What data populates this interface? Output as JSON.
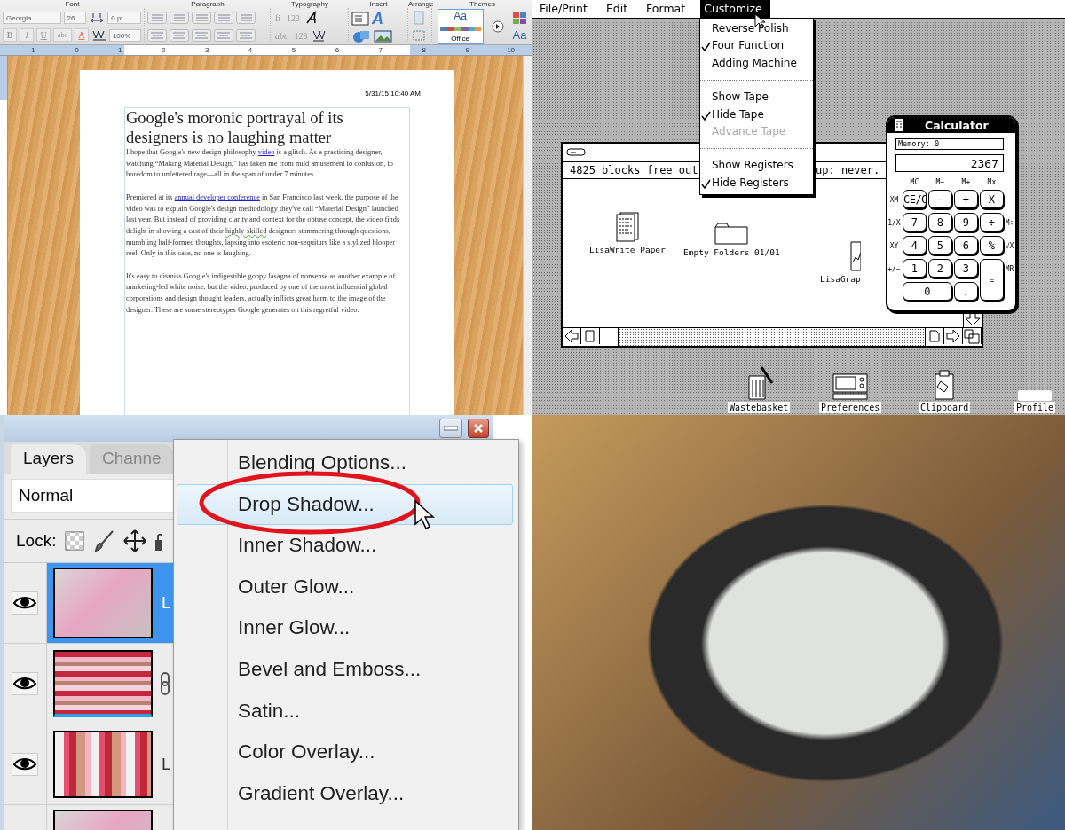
{
  "word": {
    "toolbar": {
      "groups": [
        "Font",
        "Paragraph",
        "Typography",
        "Insert",
        "Arrange",
        "Themes"
      ],
      "font": "Georgia",
      "font_size": "26",
      "spacing": "0 pt",
      "scale": "100%",
      "format_buttons": [
        {
          "label": "B",
          "kind": "bold"
        },
        {
          "label": "I",
          "kind": "italic"
        },
        {
          "label": "U",
          "kind": "underline"
        },
        {
          "label": "abc",
          "kind": "strike"
        },
        {
          "label": "A",
          "kind": "color"
        }
      ],
      "typography_buttons": [
        "fi",
        "123",
        "abc",
        "123"
      ],
      "wordart": "A",
      "theme_sample": "Aa",
      "theme_name": "Office",
      "fonts_button": "Aa"
    },
    "ruler": [
      "1",
      "0",
      "1",
      "2",
      "3",
      "4",
      "5",
      "6",
      "7",
      "8",
      "9",
      "10"
    ],
    "document": {
      "timestamp": "5/31/15 10:40 AM",
      "title": "Google's moronic portrayal of its designers is no laughing matter",
      "paragraphs": [
        [
          {
            "text": "I hope that Google's new design philosophy "
          },
          {
            "text": "video",
            "kind": "link"
          },
          {
            "text": " is a glitch. As a practicing designer, watching “Making Material Design,” has taken me from mild amusement to confusion, to boredom to unfettered rage—all in the span of under 7 minutes."
          }
        ],
        [
          {
            "text": "Premiered at its "
          },
          {
            "text": "annual developer conference",
            "kind": "link"
          },
          {
            "text": " in San Francisco last week, the purpose of the video was to explain Google's design methodology they've call “Material Design” launched last year. But instead of providing clarity and context for the obtuse concept, the video finds delight in showing a cast of their "
          },
          {
            "text": "highly-skilled",
            "kind": "grammar"
          },
          {
            "text": " designers stammering through questions, mumbling half-formed thoughts, lapsing into esoteric non-sequiturs like a stylized blooper reel. Only in this case, no one is laughing."
          }
        ],
        [
          {
            "text": "It's easy to dismiss Google's indigestible goopy lasagna of nonsense as another example of marketing-led white noise, but the video, produced by one of the most influential global corporations and design thought leaders, actually inflicts great harm to the image of the designer. These are some stereotypes Google generates on this regretful video."
          }
        ]
      ]
    }
  },
  "lisa": {
    "menus": [
      {
        "label": "File/Print",
        "selected": false
      },
      {
        "label": "Edit",
        "selected": false
      },
      {
        "label": "Format",
        "selected": false
      },
      {
        "label": "Customize",
        "selected": true
      }
    ],
    "dropdown": [
      {
        "kind": "item",
        "label": "Reverse Polish",
        "checked": false,
        "disabled": false
      },
      {
        "kind": "item",
        "label": "Four Function",
        "checked": true,
        "disabled": false
      },
      {
        "kind": "item",
        "label": "Adding Machine",
        "checked": false,
        "disabled": false
      },
      {
        "kind": "separator"
      },
      {
        "kind": "item",
        "label": "Show Tape",
        "checked": false,
        "disabled": false
      },
      {
        "kind": "item",
        "label": "Hide Tape",
        "checked": true,
        "disabled": false
      },
      {
        "kind": "item",
        "label": "Advance Tape",
        "checked": false,
        "disabled": true
      },
      {
        "kind": "separator"
      },
      {
        "kind": "item",
        "label": "Show Registers",
        "checked": false,
        "disabled": false
      },
      {
        "kind": "item",
        "label": "Hide Registers",
        "checked": true,
        "disabled": false
      }
    ],
    "window": {
      "status_left": "4825 blocks free out",
      "status_right": "up: never."
    },
    "desktop_icons": [
      {
        "label": "LisaWrite Paper",
        "kind": "document"
      },
      {
        "label": "Empty Folders 01/01",
        "kind": "folder"
      },
      {
        "label": "LisaGrap",
        "kind": "chart"
      }
    ],
    "dock_icons": [
      {
        "label": "Wastebasket",
        "kind": "trash"
      },
      {
        "label": "Preferences",
        "kind": "preferences"
      },
      {
        "label": "Clipboard",
        "kind": "clipboard"
      },
      {
        "label": "Profile",
        "kind": "profile"
      }
    ],
    "calculator": {
      "title": "Calculator",
      "memory": "Memory: 0",
      "display": "2367",
      "memory_keys": [
        "MC",
        "M−",
        "M+",
        "Mx"
      ],
      "left_labels": [
        "XM",
        "1/X",
        "XY",
        "+/−"
      ],
      "right_labels": [
        "M÷",
        "√X",
        "MR"
      ],
      "keys": [
        {
          "label": "CE/C",
          "kind": "normal"
        },
        {
          "label": "−",
          "kind": "normal"
        },
        {
          "label": "+",
          "kind": "normal"
        },
        {
          "label": "X",
          "kind": "normal"
        },
        {
          "label": "7",
          "kind": "normal"
        },
        {
          "label": "8",
          "kind": "normal"
        },
        {
          "label": "9",
          "kind": "normal"
        },
        {
          "label": "÷",
          "kind": "normal"
        },
        {
          "label": "4",
          "kind": "normal"
        },
        {
          "label": "5",
          "kind": "normal"
        },
        {
          "label": "6",
          "kind": "normal"
        },
        {
          "label": "%",
          "kind": "normal"
        },
        {
          "label": "1",
          "kind": "normal"
        },
        {
          "label": "2",
          "kind": "normal"
        },
        {
          "label": "3",
          "kind": "normal"
        },
        {
          "label": "=",
          "kind": "tall"
        },
        {
          "label": "0",
          "kind": "wide"
        },
        {
          "label": ".",
          "kind": "normal"
        }
      ]
    }
  },
  "photoshop": {
    "tabs": [
      {
        "label": "Layers",
        "selected": true
      },
      {
        "label": "Channe",
        "selected": false
      }
    ],
    "blend_mode": "Normal",
    "lock_label": "Lock:",
    "layers": [
      {
        "name": "L",
        "selected": true,
        "linked": false,
        "kind": "photo"
      },
      {
        "selected": false,
        "linked": true,
        "kind": "bands"
      },
      {
        "name": "L",
        "selected": false,
        "linked": false,
        "kind": "stripes"
      },
      {
        "selected": false,
        "linked": false,
        "kind": "photo"
      }
    ],
    "context_menu": [
      {
        "label": "Blending Options...",
        "selected": false
      },
      {
        "label": "Drop Shadow...",
        "selected": true
      },
      {
        "label": "Inner Shadow...",
        "selected": false
      },
      {
        "label": "Outer Glow...",
        "selected": false
      },
      {
        "label": "Inner Glow...",
        "selected": false
      },
      {
        "label": "Bevel and Emboss...",
        "selected": false
      },
      {
        "label": "Satin...",
        "selected": false
      },
      {
        "label": "Color Overlay...",
        "selected": false
      },
      {
        "label": "Gradient Overlay...",
        "selected": false
      }
    ]
  }
}
